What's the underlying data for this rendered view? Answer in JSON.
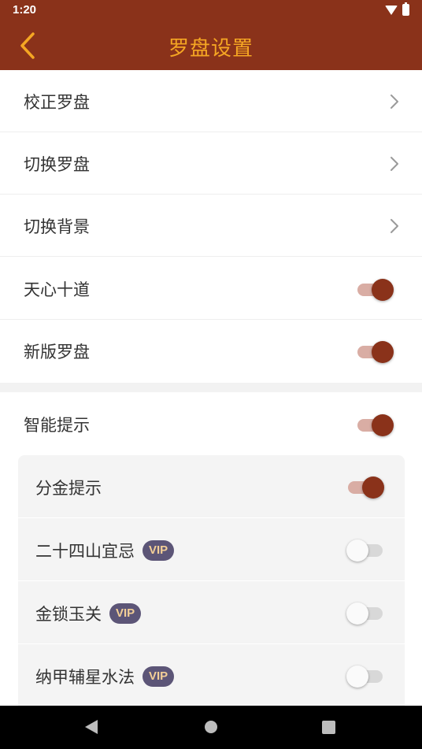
{
  "status_bar": {
    "time": "1:20",
    "icons": [
      "wifi-icon",
      "battery-icon"
    ]
  },
  "header": {
    "title": "罗盘设置",
    "back_icon": "chevron-left-icon"
  },
  "settings": [
    {
      "label": "校正罗盘",
      "type": "link"
    },
    {
      "label": "切换罗盘",
      "type": "link"
    },
    {
      "label": "切换背景",
      "type": "link"
    },
    {
      "label": "天心十道",
      "type": "toggle",
      "on": true
    },
    {
      "label": "新版罗盘",
      "type": "toggle",
      "on": true
    }
  ],
  "smart_hint": {
    "label": "智能提示",
    "on": true,
    "items": [
      {
        "label": "分金提示",
        "vip": "",
        "on": true
      },
      {
        "label": "二十四山宜忌",
        "vip": "VIP",
        "on": false
      },
      {
        "label": "金锁玉关",
        "vip": "VIP",
        "on": false
      },
      {
        "label": "纳甲辅星水法",
        "vip": "VIP",
        "on": false
      }
    ]
  },
  "nav_bar": {
    "icons": [
      "nav-back-icon",
      "nav-home-icon",
      "nav-recents-icon"
    ]
  },
  "colors": {
    "primary": "#8a321a",
    "title": "#f5a623",
    "toggle_track_on": "#d9ada4",
    "vip_bg": "#5c5577",
    "vip_text": "#f3cf97"
  }
}
